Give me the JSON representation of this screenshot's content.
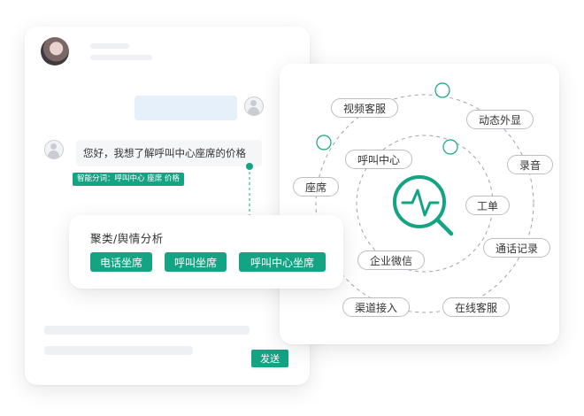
{
  "chat": {
    "customer_message": "您好，我想了解呼叫中心座席的价格",
    "segmentation_tag": "智能分词：呼叫中心 座席 价格",
    "send_label": "发送"
  },
  "cluster_panel": {
    "title": "聚类/舆情分析",
    "tags": [
      "电话坐席",
      "呼叫坐席",
      "呼叫中心坐席"
    ]
  },
  "hub": {
    "center_icon": "analytics-search-icon",
    "nodes": {
      "video_service": "视频客服",
      "dynamic_caller_id": "动态外显",
      "recording": "录音",
      "call_center": "呼叫中心",
      "seat": "座席",
      "work_order": "工单",
      "call_records": "通话记录",
      "enterprise_wechat": "企业微信",
      "channel_access": "渠道接入",
      "online_service": "在线客服"
    }
  },
  "colors": {
    "accent": "#14a383",
    "bubble": "#e6f0fb"
  }
}
